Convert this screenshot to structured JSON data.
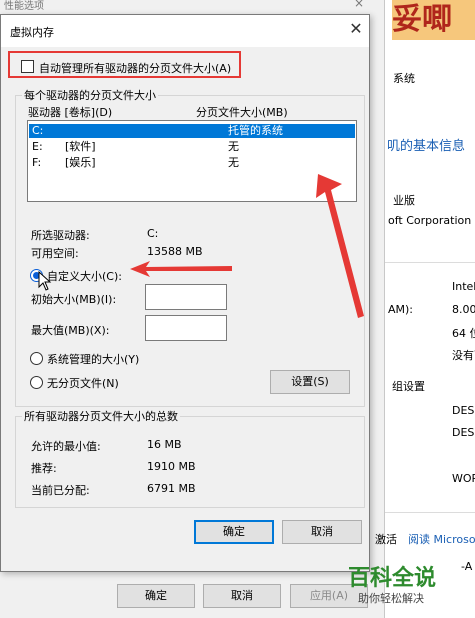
{
  "background": {
    "perf_window_title": "性能选项",
    "perf_close": "×",
    "banner_text": "妥唧",
    "system_texts": [
      "系统",
      "叽的基本信息",
      "业版",
      "oft Corporation",
      "Intel",
      "AM):",
      "8.00",
      "64 位",
      "没有可",
      "组设置",
      "DESK",
      "DESK",
      "WOR",
      "激活",
      "阅读 Microso",
      "-A"
    ],
    "buttons": {
      "ok": "确定",
      "cancel": "取消",
      "apply": "应用(A)"
    }
  },
  "dialog": {
    "title": "虚拟内存",
    "close": "✕",
    "auto_manage_label": "自动管理所有驱动器的分页文件大小(A)",
    "auto_manage_checked": false,
    "group_per_drive": "每个驱动器的分页文件大小",
    "columns": {
      "drive": "驱动器 [卷标](D)",
      "size": "分页文件大小(MB)"
    },
    "drives": [
      {
        "drive": "C:",
        "label": "",
        "size": "托管的系统",
        "selected": true
      },
      {
        "drive": "E:",
        "label": "[软件]",
        "size": "无",
        "selected": false
      },
      {
        "drive": "F:",
        "label": "[娱乐]",
        "size": "无",
        "selected": false
      }
    ],
    "selected_drive_label": "所选驱动器:",
    "selected_drive_value": "C:",
    "free_space_label": "可用空间:",
    "free_space_value": "13588 MB",
    "custom_size_label": "自定义大小(C):",
    "initial_size_label": "初始大小(MB)(I):",
    "initial_size_value": "",
    "max_size_label": "最大值(MB)(X):",
    "max_size_value": "",
    "system_managed_label": "系统管理的大小(Y)",
    "no_paging_label": "无分页文件(N)",
    "set_button": "设置(S)",
    "selected_option": "custom",
    "group_total": "所有驱动器分页文件大小的总数",
    "min_allowed_label": "允许的最小值:",
    "min_allowed_value": "16 MB",
    "recommended_label": "推荐:",
    "recommended_value": "1910 MB",
    "allocated_label": "当前已分配:",
    "allocated_value": "6791 MB",
    "ok_button": "确定",
    "cancel_button": "取消"
  },
  "watermark": {
    "main": "百科全说",
    "sub": "助你轻松解决"
  },
  "colors": {
    "annotation_red": "#e53935",
    "selection_blue": "#0078d7",
    "watermark_green": "#2e8b2e"
  }
}
